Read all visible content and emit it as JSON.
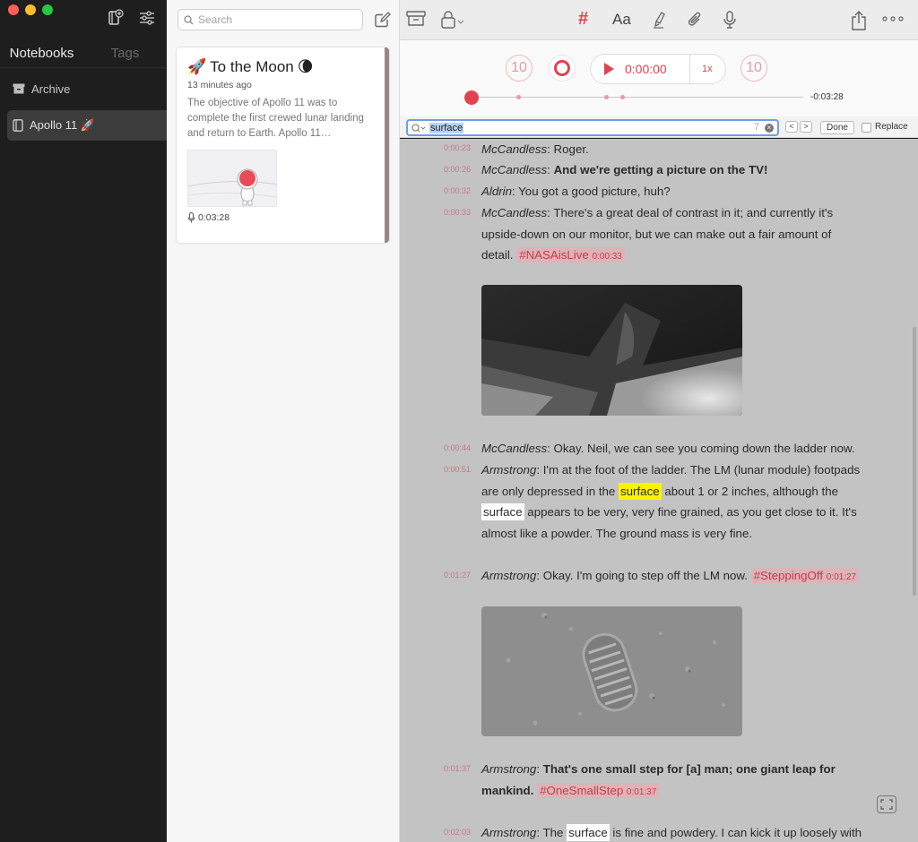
{
  "sidebar": {
    "tabs": [
      {
        "label": "Notebooks",
        "active": true
      },
      {
        "label": "Tags",
        "active": false
      }
    ],
    "items": [
      {
        "label": "Archive",
        "icon": "archive-icon"
      },
      {
        "label": "Apollo 11 🚀",
        "icon": "notebook-icon",
        "selected": true
      }
    ]
  },
  "notelist": {
    "search_placeholder": "Search",
    "note": {
      "title_emoji": "🚀",
      "title": "To the Moon",
      "title_trailing_emoji": "🌘",
      "time": "13 minutes ago",
      "excerpt": "The objective of Apollo 11 was to complete the first crewed lunar landing and return to Earth. Apollo 11…",
      "audio_duration": "0:03:28"
    }
  },
  "toolbar": {
    "hash": "#",
    "format": "Aa"
  },
  "player": {
    "skip_back": "10",
    "skip_forward": "10",
    "time": "0:00:00",
    "speed": "1x",
    "remaining": "-0:03:28"
  },
  "findbar": {
    "query": "surface",
    "count": "7",
    "prev": "<",
    "next": ">",
    "done_label": "Done",
    "replace_label": "Replace"
  },
  "transcript": [
    {
      "ts": "0:00:23",
      "speaker": "McCandless",
      "text": ": Roger."
    },
    {
      "ts": "0:00:26",
      "speaker": "McCandless",
      "text": ": ",
      "bold": "And we're getting a picture on the TV!"
    },
    {
      "ts": "0:00:32",
      "speaker": "Aldrin",
      "text": ": You got a good picture, huh?"
    },
    {
      "ts": "0:00:33",
      "speaker": "McCandless",
      "text": ": There's a great deal of contrast in it; and currently it's upside-down on our monitor, but we can make out a fair amount of detail.",
      "tag": "#NASAisLive",
      "tag_time": "0:00:33"
    },
    {
      "ts": "0:00:44",
      "speaker": "McCandless",
      "text": ": Okay. Neil, we can see you coming down the ladder now."
    },
    {
      "ts": "0:00:51",
      "speaker": "Armstrong",
      "p1": ": I'm at the foot of the ladder. The LM (lunar module) footpads are only depressed in the ",
      "hl1": "surface",
      "p2": " about 1 or 2 inches, although the ",
      "hl2": "surface",
      "p3": " appears to be very, very fine grained, as you get close to it. It's almost like a powder. The ground mass is very fine."
    },
    {
      "ts": "0:01:27",
      "speaker": "Armstrong",
      "text": ": Okay. I'm going to step off the LM now.",
      "tag": "#SteppingOff",
      "tag_time": "0:01:27"
    },
    {
      "ts": "0:01:37",
      "speaker": "Armstrong",
      "text": ": ",
      "bold": "That's one small step for [a] man; one giant leap for mankind.",
      "tag": "#OneSmallStep",
      "tag_time": "0:01:37"
    },
    {
      "ts": "0:02:03",
      "speaker": "Armstrong",
      "p1": ": The ",
      "hl": "surface",
      "p2": " is fine and powdery. I can kick it up loosely with"
    }
  ],
  "colors": {
    "accent": "#e2424f",
    "sidebar_bg": "#1e1e1e",
    "editor_bg": "#c3c3c3",
    "highlight_current": "#fff200"
  }
}
